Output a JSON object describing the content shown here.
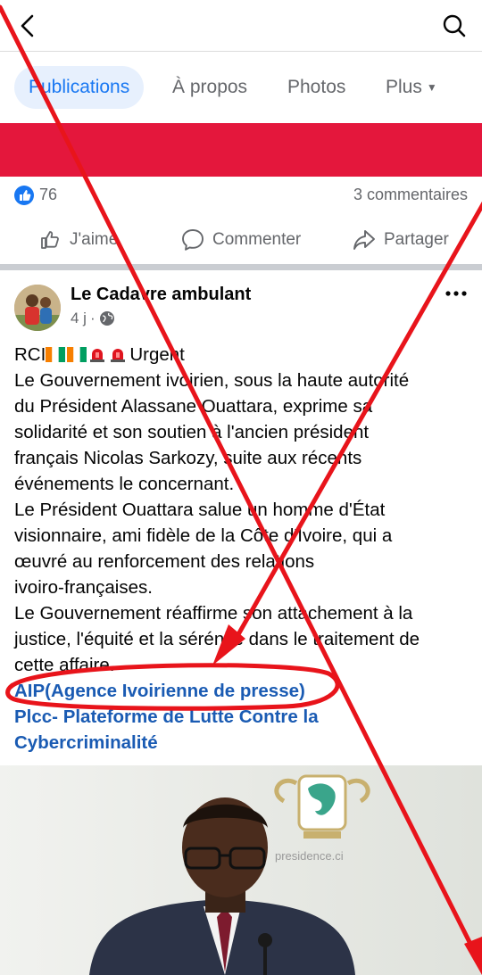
{
  "header": {
    "tabs": [
      {
        "label": "Publications",
        "active": true
      },
      {
        "label": "À propos",
        "active": false
      },
      {
        "label": "Photos",
        "active": false
      },
      {
        "label": "Plus",
        "active": false
      }
    ]
  },
  "post_stats": {
    "likes": "76",
    "comments": "3 commentaires"
  },
  "actions": {
    "like": "J'aime",
    "comment": "Commenter",
    "share": "Partager"
  },
  "post": {
    "author": "Le Cadavre ambulant",
    "time": "4 j",
    "separator": "·",
    "headline_prefix": "RCI",
    "headline_suffix": "Urgent",
    "lines": [
      "Le Gouvernement ivoirien, sous la haute autorité",
      "du Président Alassane Ouattara, exprime sa",
      "solidarité et son soutien à l'ancien président",
      "français Nicolas Sarkozy, suite aux récents",
      "événements le concernant.",
      "Le Président Ouattara salue un homme d'État",
      "visionnaire, ami fidèle de la Côte d'Ivoire, qui a",
      "œuvré au renforcement des relations",
      "ivoiro-françaises.",
      "Le Gouvernement réaffirme son attachement à la",
      "justice, l'équité et la sérénité dans le traitement de",
      "cette affaire."
    ],
    "links": [
      "AIP(Agence Ivoirienne de presse)",
      "Plcc- Plateforme de Lutte Contre la",
      "Cybercriminalité"
    ],
    "photo_watermark": "presidence.ci"
  },
  "colors": {
    "accent": "#1877f2",
    "banner": "#e4173c",
    "annotation": "#e8141b",
    "link": "#1a5bb3"
  },
  "icons": [
    "back-arrow-icon",
    "search-icon",
    "caret-down-icon",
    "like-thumb-icon",
    "comment-bubble-icon",
    "share-arrow-icon",
    "globe-icon",
    "more-dots-icon",
    "flag-ci-icon",
    "siren-icon"
  ]
}
